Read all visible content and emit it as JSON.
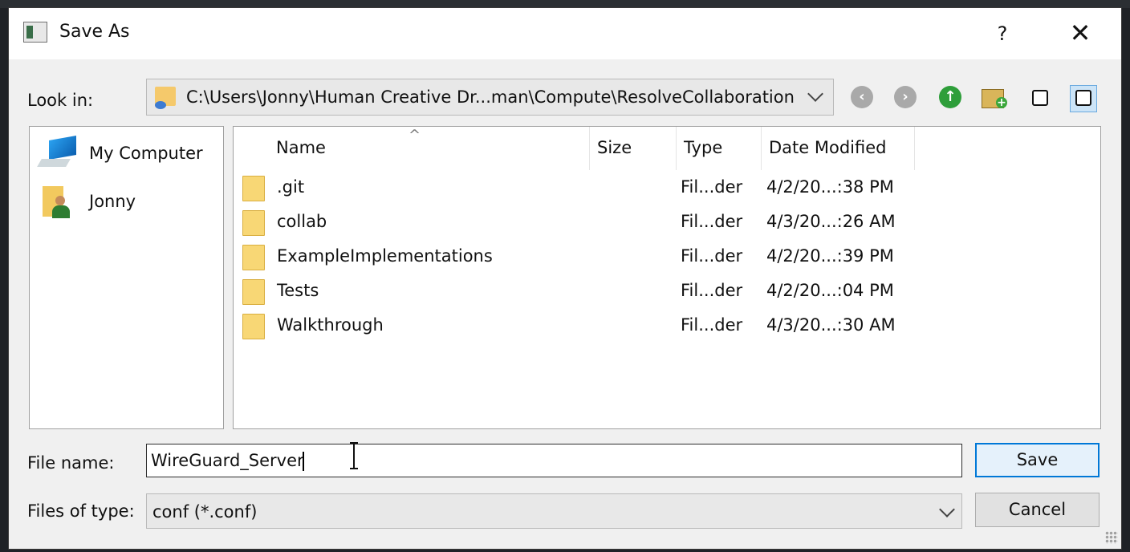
{
  "window": {
    "title": "Save As",
    "help": "?",
    "close": "✕"
  },
  "look_in": {
    "label": "Look in:",
    "path": "C:\\Users\\Jonny\\Human Creative Dr...man\\Compute\\ResolveCollaboration"
  },
  "toolbar": {
    "back_icon": "back-arrow-icon",
    "forward_icon": "forward-arrow-icon",
    "up_icon": "up-arrow-icon",
    "new_folder_icon": "new-folder-icon",
    "list_view_icon": "list-view-icon",
    "detail_view_icon": "detail-view-icon",
    "active_view": "detail"
  },
  "places": [
    {
      "label": "My Computer",
      "icon": "computer-icon"
    },
    {
      "label": "Jonny",
      "icon": "user-folder-icon"
    }
  ],
  "columns": [
    "Name",
    "Size",
    "Type",
    "Date Modified"
  ],
  "files": [
    {
      "name": ".git",
      "size": "",
      "type": "Fil...der",
      "date": "4/2/20...:38 PM"
    },
    {
      "name": "collab",
      "size": "",
      "type": "Fil...der",
      "date": "4/3/20...:26 AM"
    },
    {
      "name": "ExampleImplementations",
      "size": "",
      "type": "Fil...der",
      "date": "4/2/20...:39 PM"
    },
    {
      "name": "Tests",
      "size": "",
      "type": "Fil...der",
      "date": "4/2/20...:04 PM"
    },
    {
      "name": "Walkthrough",
      "size": "",
      "type": "Fil...der",
      "date": "4/3/20...:30 AM"
    }
  ],
  "file_name": {
    "label": "File name:",
    "value": "WireGuard_Server"
  },
  "file_type": {
    "label": "Files of type:",
    "value": "conf (*.conf)"
  },
  "buttons": {
    "save": "Save",
    "cancel": "Cancel"
  },
  "colors": {
    "accent": "#0078d7",
    "dialog_bg": "#f0f0f0",
    "folder": "#f8d775"
  }
}
